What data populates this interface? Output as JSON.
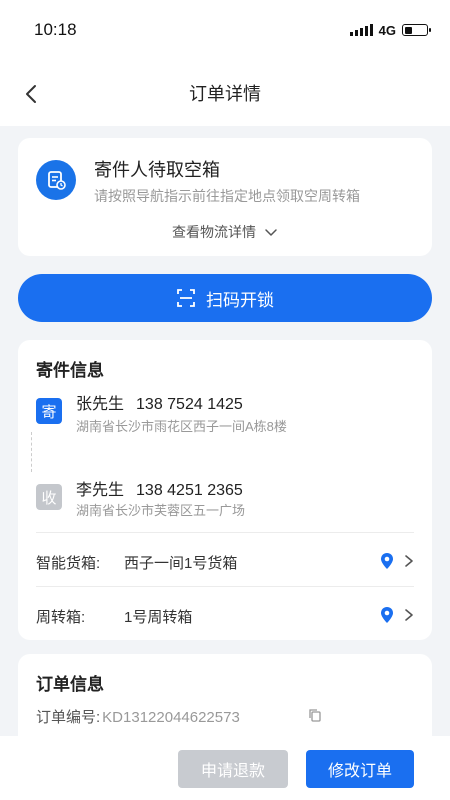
{
  "status_bar": {
    "time": "10:18",
    "network": "4G"
  },
  "nav": {
    "title": "订单详情"
  },
  "status_card": {
    "title": "寄件人待取空箱",
    "subtitle": "请按照导航指示前往指定地点领取空周转箱",
    "logistics_link": "查看物流详情"
  },
  "scan_button": {
    "label": "扫码开锁"
  },
  "shipping": {
    "section_title": "寄件信息",
    "sender": {
      "tag": "寄",
      "name": "张先生",
      "phone": "138 7524 1425",
      "address": "湖南省长沙市雨花区西子一间A栋8楼"
    },
    "receiver": {
      "tag": "收",
      "name": "李先生",
      "phone": "138 4251 2365",
      "address": "湖南省长沙市芙蓉区五一广场"
    },
    "locker": {
      "label": "智能货箱:",
      "value": "西子一间1号货箱"
    },
    "box": {
      "label": "周转箱:",
      "value": "1号周转箱"
    }
  },
  "order_info": {
    "section_title": "订单信息",
    "order_no_label": "订单编号:",
    "order_no": "KD13122044622573"
  },
  "footer": {
    "refund_label": "申请退款",
    "modify_label": "修改订单"
  },
  "colors": {
    "primary": "#1a6ff0",
    "disabled": "#c8cbd0",
    "background": "#f2f4f7"
  }
}
